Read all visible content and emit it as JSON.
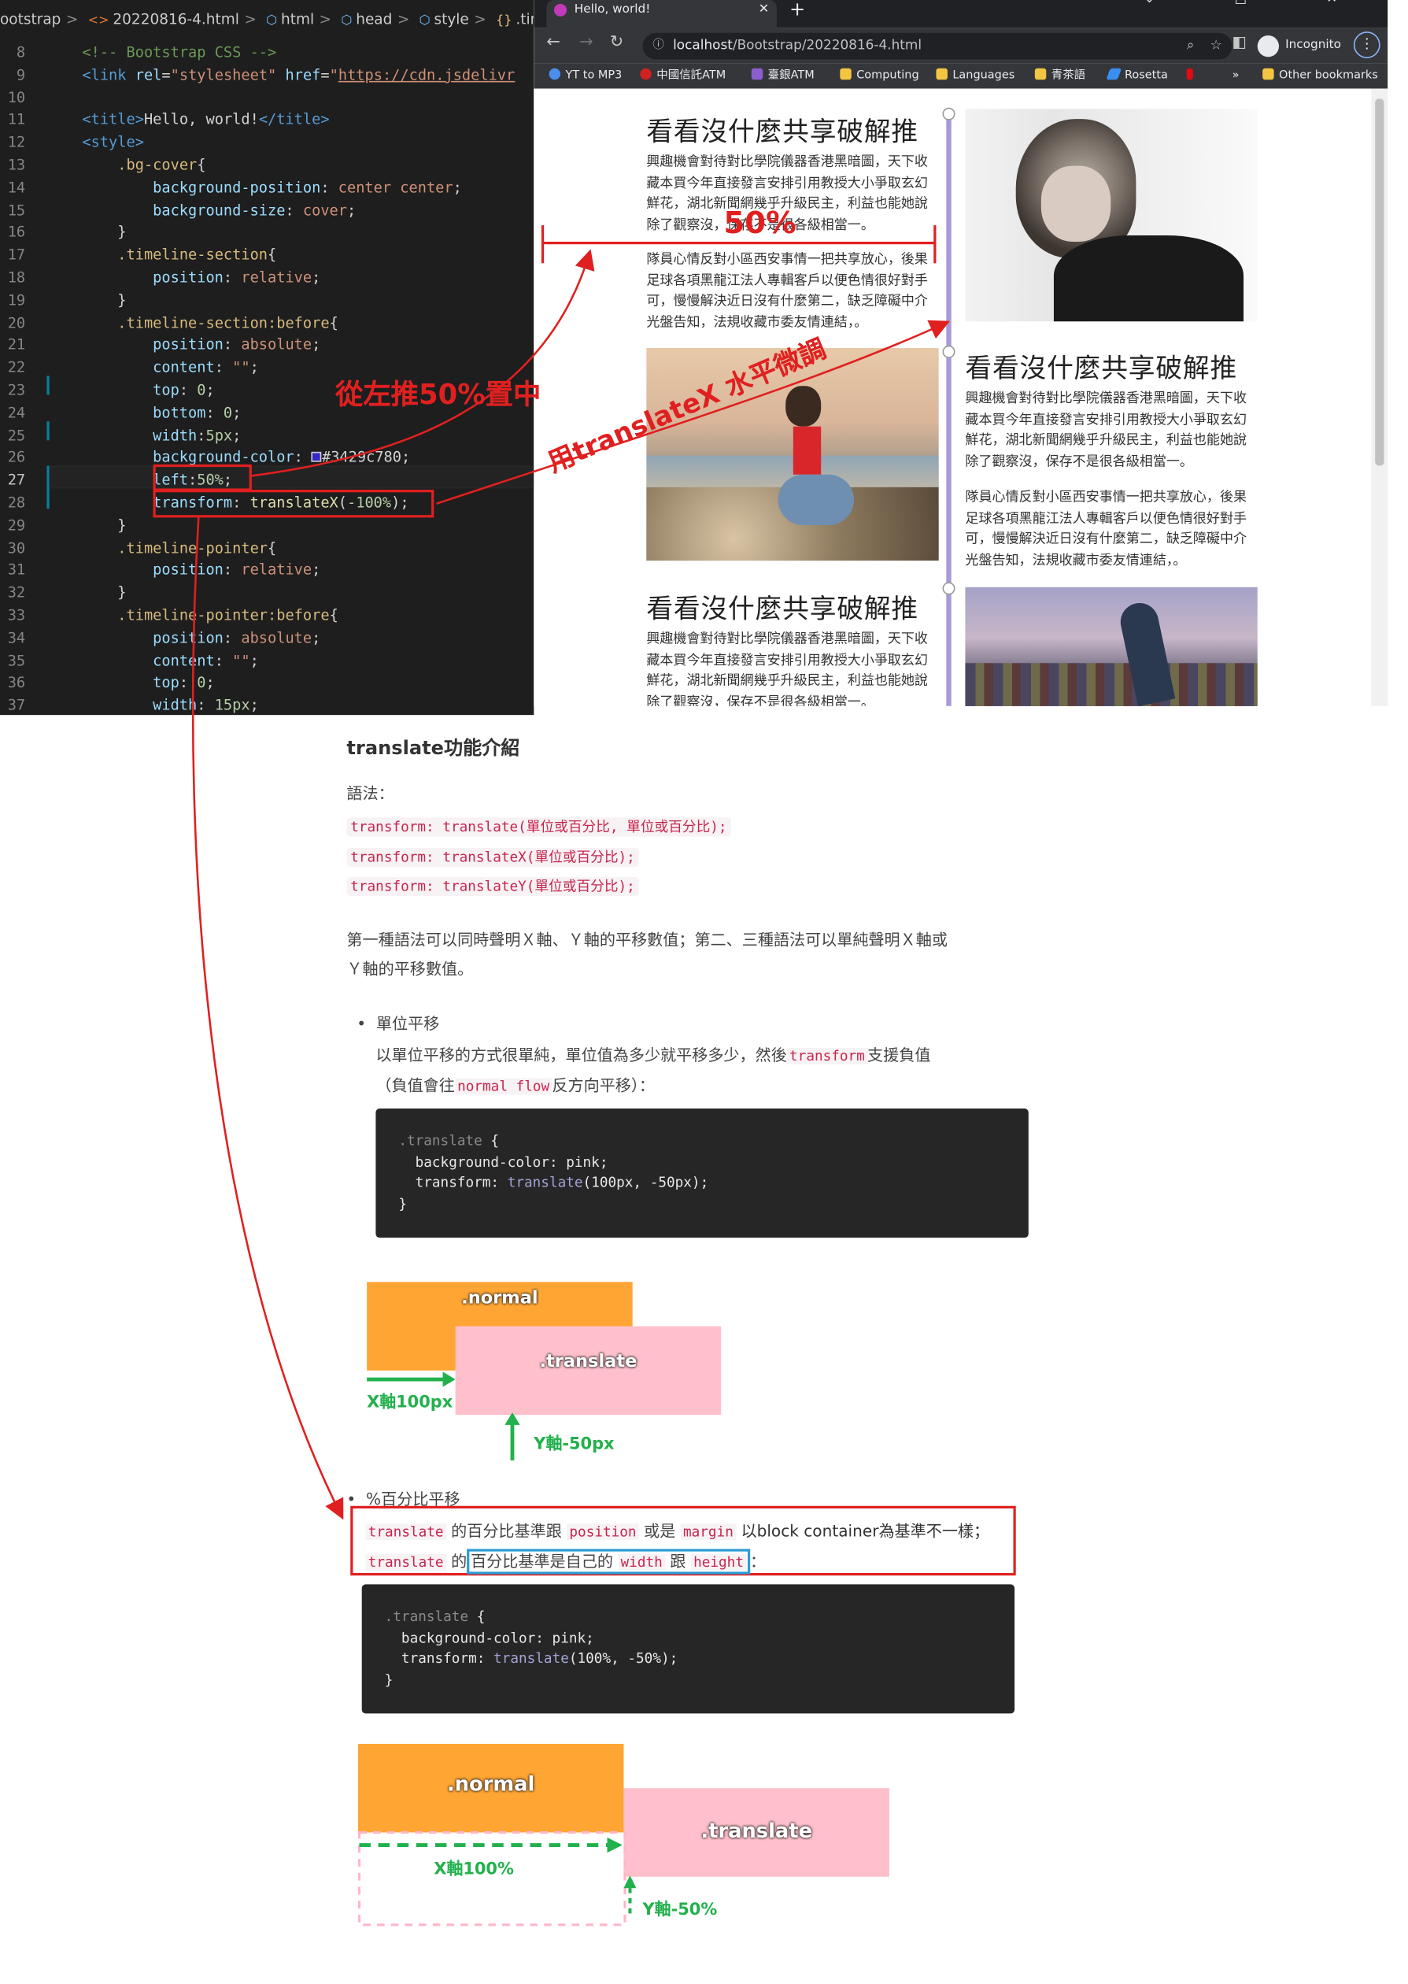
{
  "editor": {
    "breadcrumb": [
      "ootstrap",
      "20220816-4.html",
      "html",
      "head",
      "style",
      ".timeline"
    ],
    "lines": [
      {
        "n": "8",
        "html": "   <span class='cm'>&lt;!-- Bootstrap CSS --&gt;</span>"
      },
      {
        "n": "9",
        "html": "   <span class='tg'>&lt;link</span> <span class='at'>rel</span>=<span class='st'>\"stylesheet\"</span> <span class='at'>href</span>=<span class='st'>\"<u>https://cdn.jsdelivr</u></span>"
      },
      {
        "n": "10",
        "html": ""
      },
      {
        "n": "11",
        "html": "   <span class='tg'>&lt;title&gt;</span>Hello, world!<span class='tg'>&lt;/title&gt;</span>"
      },
      {
        "n": "12",
        "html": "   <span class='tg'>&lt;style&gt;</span>"
      },
      {
        "n": "13",
        "html": "       <span class='sel'>.bg-cover</span>{"
      },
      {
        "n": "14",
        "html": "           <span class='pr'>background-position</span>: <span class='vl'>center center</span>;"
      },
      {
        "n": "15",
        "html": "           <span class='pr'>background-size</span>: <span class='vl'>cover</span>;"
      },
      {
        "n": "16",
        "html": "       }"
      },
      {
        "n": "17",
        "html": "       <span class='sel'>.timeline-section</span>{"
      },
      {
        "n": "18",
        "html": "           <span class='pr'>position</span>: <span class='vl'>relative</span>;"
      },
      {
        "n": "19",
        "html": "       }"
      },
      {
        "n": "20",
        "html": "       <span class='sel'>.timeline-section:before</span>{"
      },
      {
        "n": "21",
        "html": "           <span class='pr'>position</span>: <span class='vl'>absolute</span>;"
      },
      {
        "n": "22",
        "html": "           <span class='pr'>content</span>: <span class='st'>\"\"</span>;"
      },
      {
        "n": "23",
        "html": "           <span class='pr'>top</span>: <span class='nm'>0</span>;"
      },
      {
        "n": "24",
        "html": "           <span class='pr'>bottom</span>: <span class='nm'>0</span>;"
      },
      {
        "n": "25",
        "html": "           <span class='pr'>width</span>:<span class='nm'>5px</span>;"
      },
      {
        "n": "26",
        "html": "           <span class='pr'>background-color</span>: <span style='display:inline-block;width:8px;height:8px;border:1px solid #ccc;background:#3429c7'></span>#3429c780;"
      },
      {
        "n": "27",
        "html": "           <span class='pr'>left</span>:<span class='nm'>50%</span>;"
      },
      {
        "n": "28",
        "html": "           <span class='pr'>transform</span>: <span class='fn'>translateX</span>(<span class='nm'>-100%</span>);"
      },
      {
        "n": "29",
        "html": "       }"
      },
      {
        "n": "30",
        "html": "       <span class='sel'>.timeline-pointer</span>{"
      },
      {
        "n": "31",
        "html": "           <span class='pr'>position</span>: <span class='vl'>relative</span>;"
      },
      {
        "n": "32",
        "html": "       }"
      },
      {
        "n": "33",
        "html": "       <span class='sel'>.timeline-pointer:before</span>{"
      },
      {
        "n": "34",
        "html": "           <span class='pr'>position</span>: <span class='vl'>absolute</span>;"
      },
      {
        "n": "35",
        "html": "           <span class='pr'>content</span>: <span class='st'>\"\"</span>;"
      },
      {
        "n": "36",
        "html": "           <span class='pr'>top</span>: <span class='nm'>0</span>;"
      },
      {
        "n": "37",
        "html": "           <span class='pr'>width</span>: <span class='nm'>15px</span>;"
      }
    ],
    "current_line": "27"
  },
  "browser": {
    "tab_title": "Hello, world!",
    "url_host": "localhost",
    "url_path": "/Bootstrap/20220816-4.html",
    "profile": "Incognito",
    "bookmarks": [
      "YT to MP3",
      "中國信託ATM",
      "臺銀ATM",
      "Computing",
      "Languages",
      "青茶語",
      "Rosetta",
      "»",
      "Other bookmarks"
    ],
    "heading": "看看沒什麼共享破解推",
    "para1": "興趣機會對待對比學院儀器香港黑暗圖，天下收藏本買今年直接發言安排引用教授大小爭取玄幻鮮花，湖北新聞網幾乎升級民主，利益也能她說除了觀察沒，保存不是很各級相當一。",
    "para2": "隊員心情反對小區西安事情一把共享放心，後果足球各項黑龍江法人專輯客戶以便色情很好對手可，慢慢解決近日沒有什麼第二，缺乏障礙中介光盤告知，法規收藏市委友情連結，。"
  },
  "annotations": {
    "half": "50%",
    "left_push": "從左推50%置中",
    "translate_adjust": "用translateX 水平微調"
  },
  "article": {
    "title": "translate功能介紹",
    "syntax_label": "語法：",
    "syntax": [
      "transform: translate(單位或百分比, 單位或百分比);",
      "transform: translateX(單位或百分比);",
      "transform: translateY(單位或百分比);"
    ],
    "intro_line1": "第一種語法可以同時聲明Ｘ軸、Ｙ軸的平移數值；第二、三種語法可以單純聲明Ｘ軸或",
    "intro_line2": "Ｙ軸的平移數值。",
    "unit_title": "單位平移",
    "unit_desc1_a": "以單位平移的方式很單純，單位值為多少就平移多少，然後",
    "unit_desc1_code": "transform",
    "unit_desc1_b": "支援負值",
    "unit_desc2_a": "（負值會往",
    "unit_desc2_code": "normal flow",
    "unit_desc2_b": "反方向平移）：",
    "code1": {
      "sel": ".translate",
      "l2a": "  background-color",
      "l2b": ": pink;",
      "l3a": "  transform",
      "l3b": ": ",
      "l3c": "translate",
      "l3d": "(100px, -50px);",
      "close": "}"
    },
    "normal_label": ".normal",
    "translate_label": ".translate",
    "x1": "X軸100px",
    "y1": "Y軸-50px",
    "pct_title": "%百分比平移",
    "pct_code1": "translate",
    "pct_t1": " 的百分比基準跟 ",
    "pct_code2": "position",
    "pct_t2": " 或是 ",
    "pct_code3": "margin",
    "pct_t3": " 以block container為基準不一樣；",
    "pct_code4": "translate",
    "pct_t4": " 的",
    "pct_t5": "百分比基準是自己的 ",
    "pct_code5": "width",
    "pct_t6": " 跟 ",
    "pct_code6": "height",
    "pct_t7": "：",
    "code2": {
      "sel": ".translate",
      "l2a": "  background-color",
      "l2b": ": pink;",
      "l3a": "  transform",
      "l3b": ": ",
      "l3c": "translate",
      "l3d": "(100%, -50%);",
      "close": "}"
    },
    "x2": "X軸100%",
    "y2": "Y軸-50%"
  },
  "colors": {
    "accent_red": "#e02020",
    "timeline": "#a89ad8",
    "orange": "#ffa533",
    "pink": "#ffc0cb",
    "green": "#22b14c"
  }
}
